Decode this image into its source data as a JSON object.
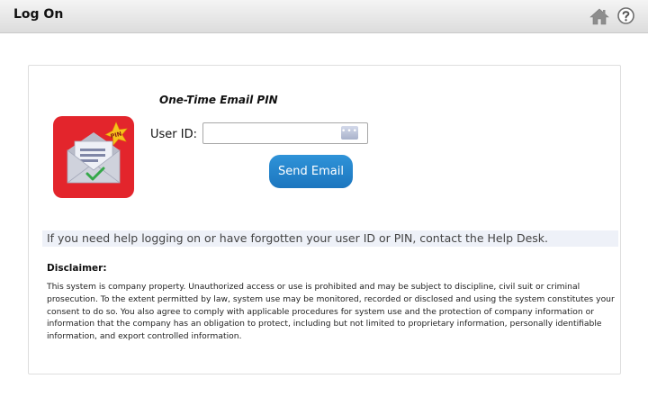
{
  "header": {
    "title": "Log On"
  },
  "form": {
    "heading": "One-Time Email PIN",
    "userid_label": "User ID:",
    "userid_value": "",
    "key_icon_glyph": "•••",
    "send_button_label": "Send Email"
  },
  "graphic": {
    "badge_text": "PIN",
    "background_color": "#e3252c"
  },
  "help_text": "If you need help logging on or have forgotten your user ID or PIN, contact the Help Desk.",
  "disclaimer": {
    "heading": "Disclaimer:",
    "body": "This system is company property. Unauthorized access or use is prohibited and may be subject to discipline, civil suit or criminal prosecution. To the extent permitted by law, system use may be monitored, recorded or disclosed and using the system constitutes your consent to do so. You also agree to comply with applicable procedures for system use and the protection of company information or information that the company has an obligation to protect, including but not limited to proprietary information, personally identifiable information, and export controlled information."
  },
  "colors": {
    "accent": "#2384cc",
    "header_gradient_top": "#f4f4f4",
    "header_gradient_bottom": "#dcdcdc"
  },
  "icons": [
    "home-icon",
    "help-icon",
    "envelope-pin-icon",
    "key-icon"
  ]
}
